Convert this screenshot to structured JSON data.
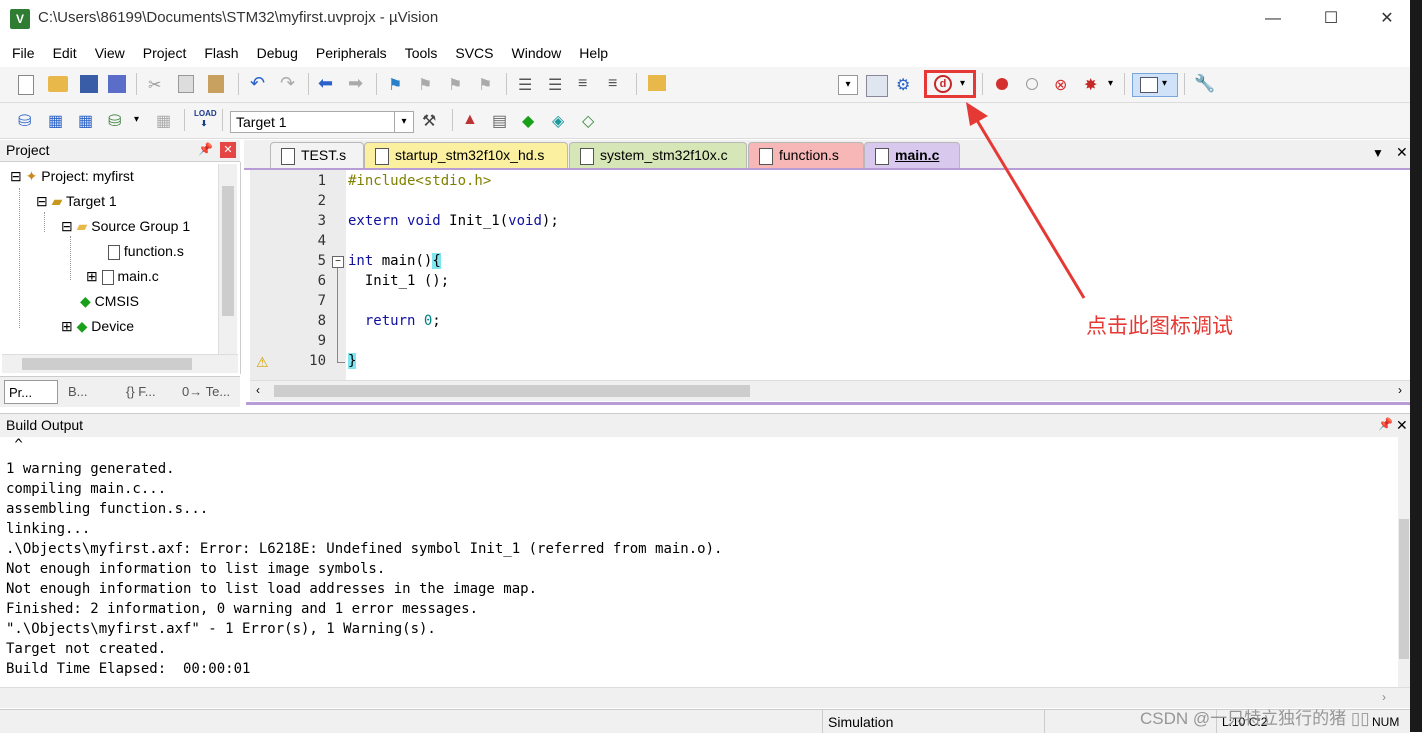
{
  "window": {
    "title": "C:\\Users\\86199\\Documents\\STM32\\myfirst.uvprojx - µVision",
    "app_icon": "V",
    "minimize": "—",
    "maximize": "☐",
    "close": "✕"
  },
  "menu": [
    "File",
    "Edit",
    "View",
    "Project",
    "Flash",
    "Debug",
    "Peripherals",
    "Tools",
    "SVCS",
    "Window",
    "Help"
  ],
  "toolbar2": {
    "target_select": "Target 1"
  },
  "project_panel": {
    "title": "Project",
    "tree": [
      {
        "label": "Project: myfirst",
        "expander": "⊟"
      },
      {
        "label": "Target 1",
        "expander": "⊟"
      },
      {
        "label": "Source Group 1",
        "expander": "⊟"
      },
      {
        "label": "function.s",
        "expander": ""
      },
      {
        "label": "main.c",
        "expander": "⊞"
      },
      {
        "label": "CMSIS",
        "expander": ""
      },
      {
        "label": "Device",
        "expander": "⊞"
      }
    ],
    "bottom_tabs": [
      "Pr...",
      "B...",
      "{} F...",
      "0→ Te..."
    ]
  },
  "editor": {
    "tabs": [
      {
        "label": "TEST.s",
        "color": "#f3f3f3"
      },
      {
        "label": "startup_stm32f10x_hd.s",
        "color": "#fbf0a0"
      },
      {
        "label": "system_stm32f10x.c",
        "color": "#d6e6b6"
      },
      {
        "label": "function.s",
        "color": "#f7b7b7"
      },
      {
        "label": "main.c",
        "color": "#d8c8ee"
      }
    ],
    "line_numbers": [
      "1",
      "2",
      "3",
      "4",
      "5",
      "6",
      "7",
      "8",
      "9",
      "10"
    ],
    "lines": {
      "l1": "#include<stdio.h>",
      "l3_kw1": "extern",
      "l3_kw2": "void",
      "l3_rest1": " Init_1(",
      "l3_kw3": "void",
      "l3_rest2": ");",
      "l5_kw": "int",
      "l5_rest": " main()",
      "l5_brace": "{",
      "l6": "  Init_1 ();",
      "l8_kw": "  return",
      "l8_num": " 0",
      "l8_rest": ";",
      "l10_brace": "}"
    }
  },
  "annotation": {
    "text": "点击此图标调试",
    "color": "#e53935"
  },
  "build_output": {
    "title": "Build Output",
    "lines": [
      " ^",
      "1 warning generated.",
      "compiling main.c...",
      "assembling function.s...",
      "linking...",
      ".\\Objects\\myfirst.axf: Error: L6218E: Undefined symbol Init_1 (referred from main.o).",
      "Not enough information to list image symbols.",
      "Not enough information to list load addresses in the image map.",
      "Finished: 2 information, 0 warning and 1 error messages.",
      "\".\\Objects\\myfirst.axf\" - 1 Error(s), 1 Warning(s).",
      "Target not created.",
      "Build Time Elapsed:  00:00:01"
    ]
  },
  "statusbar": {
    "mode": "Simulation",
    "position": "L:10 C:2",
    "num": "NUM"
  },
  "watermark": "CSDN @一只特立独行的猪 ▯▯"
}
